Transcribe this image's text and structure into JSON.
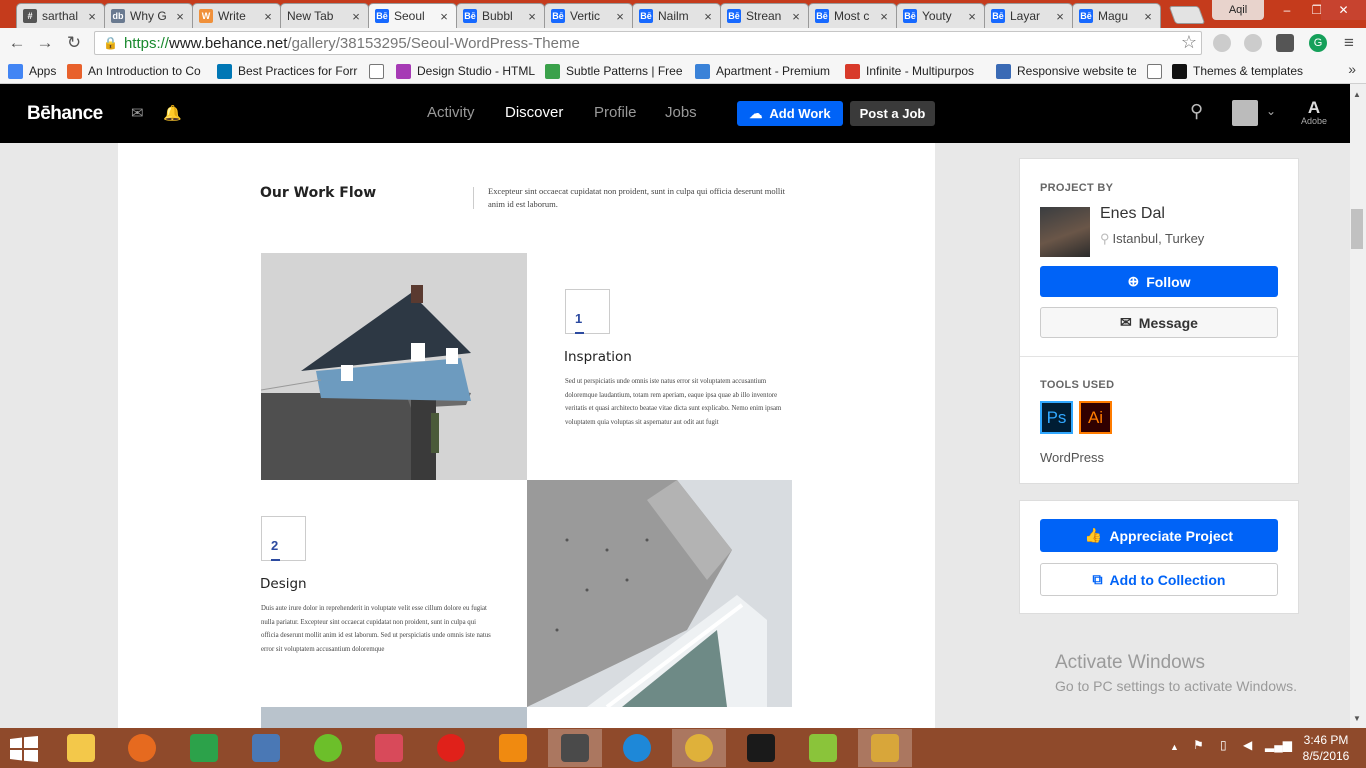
{
  "browser": {
    "tabs": [
      {
        "label": "sarthal",
        "favicon": "#",
        "color": "#555555"
      },
      {
        "label": "Why G",
        "favicon": "db",
        "color": "#6a7a90"
      },
      {
        "label": "Write",
        "favicon": "W",
        "color": "#f0903a"
      },
      {
        "label": "New Tab",
        "favicon": "",
        "color": ""
      },
      {
        "label": "Seoul",
        "favicon": "Bē",
        "color": "#1769ff"
      },
      {
        "label": "Bubbl",
        "favicon": "Bē",
        "color": "#1769ff"
      },
      {
        "label": "Vertic",
        "favicon": "Bē",
        "color": "#1769ff"
      },
      {
        "label": "Nailm",
        "favicon": "Bē",
        "color": "#1769ff"
      },
      {
        "label": "Strean",
        "favicon": "Bē",
        "color": "#1769ff"
      },
      {
        "label": "Most c",
        "favicon": "Bē",
        "color": "#1769ff"
      },
      {
        "label": "Youty",
        "favicon": "Bē",
        "color": "#1769ff"
      },
      {
        "label": "Layar",
        "favicon": "Bē",
        "color": "#1769ff"
      },
      {
        "label": "Magu",
        "favicon": "Bē",
        "color": "#1769ff"
      }
    ],
    "active_tab": 4,
    "profile_name": "Aqil",
    "url": {
      "scheme": "https://",
      "domain": "www.behance.net",
      "path": "/gallery/38153295/Seoul-WordPress-Theme"
    },
    "bookmarks": [
      {
        "label": "Apps",
        "icon": "apps-icon",
        "color": "#4285f4"
      },
      {
        "label": "An Introduction to Co",
        "icon": "plus-icon",
        "color": "#e8612c"
      },
      {
        "label": "Best Practices for Forr",
        "icon": "linkedin-icon",
        "color": "#0077b5"
      },
      {
        "label": "",
        "icon": "page-icon",
        "color": "#ffffff"
      },
      {
        "label": "Design Studio - HTML",
        "icon": "d-icon",
        "color": "#a63ab5"
      },
      {
        "label": "Subtle Patterns | Free",
        "icon": "pattern-icon",
        "color": "#3aa14a"
      },
      {
        "label": "Apartment - Premium",
        "icon": "house-icon",
        "color": "#3a82d8"
      },
      {
        "label": "Infinite - Multipurpos",
        "icon": "wp-icon",
        "color": "#d83a2a"
      },
      {
        "label": "Responsive website te",
        "icon": "shield-icon",
        "color": "#3a6ab5"
      },
      {
        "label": "",
        "icon": "page-icon",
        "color": "#ffffff"
      },
      {
        "label": "Themes & templates",
        "icon": "w-icon",
        "color": "#111111"
      }
    ]
  },
  "behance": {
    "logo": "Bēhance",
    "nav": [
      "Activity",
      "Discover",
      "Profile",
      "Jobs"
    ],
    "current_nav": "Discover",
    "add_work": "Add Work",
    "post_job": "Post a Job",
    "adobe": "Adobe"
  },
  "project": {
    "workflow_title": "Our Work Flow",
    "workflow_text": "Excepteur sint occaecat cupidatat non proident, sunt in culpa qui officia deserunt mollit anim id est laborum.",
    "steps": [
      {
        "num": "1",
        "title": "Inspration",
        "text": "Sed ut perspiciatis unde omnis iste natus error sit voluptatem accusantium doloremque laudantium, totam rem aperiam, eaque ipsa quae ab illo inventore veritatis et quasi architecto beatae vitae dicta sunt explicabo. Nemo enim ipsam voluptatem quia voluptas sit aspernatur aut odit aut fugit"
      },
      {
        "num": "2",
        "title": "Design",
        "text": "Duis aute irure dolor in reprehenderit in voluptate velit esse cillum dolore eu fugiat nulla pariatur. Excepteur sint occaecat cupidatat non proident, sunt in culpa qui officia deserunt mollit anim id est laborum. Sed ut perspiciatis unde omnis iste natus error sit voluptatem accusantium doloremque"
      }
    ]
  },
  "sidebar": {
    "project_by_label": "PROJECT BY",
    "owner_name": "Enes Dal",
    "owner_location": "Istanbul, Turkey",
    "follow": "Follow",
    "message": "Message",
    "tools_label": "TOOLS USED",
    "tools": [
      "Ps",
      "Ai"
    ],
    "tool_text": "WordPress",
    "appreciate": "Appreciate Project",
    "add_collection": "Add to Collection"
  },
  "watermark": {
    "line1": "Activate Windows",
    "line2": "Go to PC settings to activate Windows."
  },
  "taskbar": {
    "time": "3:46 PM",
    "date": "8/5/2016",
    "apps": [
      {
        "name": "file-explorer-icon",
        "color": "#f3c84a"
      },
      {
        "name": "firefox-icon",
        "color": "#e66a1f"
      },
      {
        "name": "store-icon",
        "color": "#2ca24a"
      },
      {
        "name": "email-app-icon",
        "color": "#4a78b5"
      },
      {
        "name": "frog-app-icon",
        "color": "#6cbf2a"
      },
      {
        "name": "scissors-app-icon",
        "color": "#d84a5a"
      },
      {
        "name": "opera-icon",
        "color": "#e0211a"
      },
      {
        "name": "vlc-icon",
        "color": "#f08a10"
      },
      {
        "name": "sublime-icon",
        "color": "#4a4a4a"
      },
      {
        "name": "ie-icon",
        "color": "#1e88d8"
      },
      {
        "name": "chrome-icon",
        "color": "#dfb13a"
      },
      {
        "name": "e-app-icon",
        "color": "#1a1a1a"
      },
      {
        "name": "books-app-icon",
        "color": "#8ac43a"
      },
      {
        "name": "git-app-icon",
        "color": "#d8a63a"
      }
    ]
  }
}
